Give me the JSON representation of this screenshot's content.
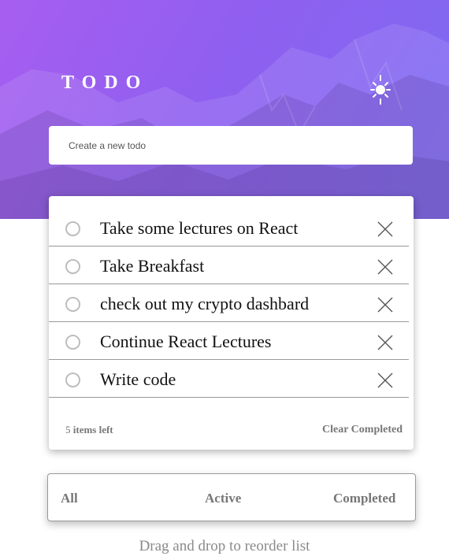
{
  "header": {
    "title": "TODO"
  },
  "new_todo": {
    "placeholder": "Create a new todo"
  },
  "todos": [
    {
      "text": "Take some lectures on React",
      "completed": false
    },
    {
      "text": "Take Breakfast",
      "completed": false
    },
    {
      "text": "check out my crypto dashbard",
      "completed": false
    },
    {
      "text": "Continue React Lectures",
      "completed": false
    },
    {
      "text": "Write code",
      "completed": false
    }
  ],
  "footer": {
    "items_left_count": "5",
    "items_left_label": "items left",
    "clear_completed": "Clear Completed"
  },
  "filters": {
    "all": "All",
    "active": "Active",
    "completed": "Completed"
  },
  "hint": "Drag and drop to reorder list",
  "colors": {
    "gradient_start": "#a75ef0",
    "gradient_end": "#7c6cf2",
    "text_muted": "#777777"
  },
  "icons": {
    "theme_toggle": "sun-icon",
    "delete": "cross-icon",
    "checkbox": "circle-outline"
  }
}
